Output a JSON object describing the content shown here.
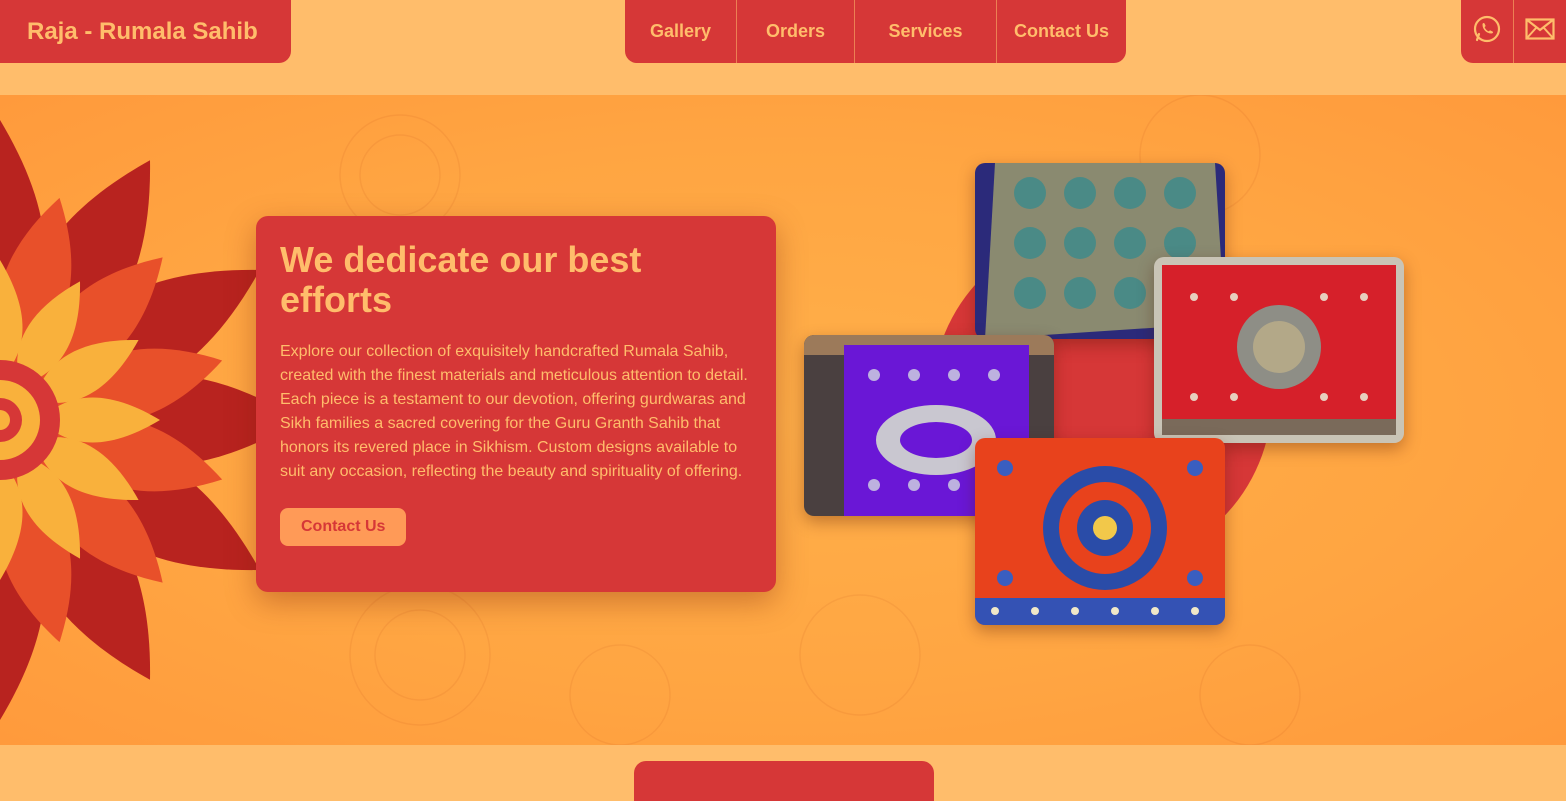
{
  "brand": {
    "name": "Raja - Rumala Sahib"
  },
  "nav": {
    "items": [
      {
        "label": "Gallery"
      },
      {
        "label": "Orders"
      },
      {
        "label": "Services"
      },
      {
        "label": "Contact Us"
      }
    ]
  },
  "contact_icons": [
    "whatsapp-icon",
    "mail-icon"
  ],
  "hero": {
    "title": "We dedicate our best efforts",
    "description": "Explore our collection of exquisitely handcrafted Rumala Sahib, created with the finest materials and meticulous attention to detail. Each piece is a testament to our devotion, offering gurdwaras and Sikh families a sacred covering for the Guru Granth Sahib that honors its revered place in Sikhism. Custom designs available to suit any occasion, reflecting the beauty and spirituality of offering.",
    "cta_label": "Contact Us"
  },
  "colors": {
    "primary_red": "#d63737",
    "accent_orange": "#ffbd6b",
    "hero_orange": "#ffa542",
    "cta_bg": "#ff9a57"
  }
}
